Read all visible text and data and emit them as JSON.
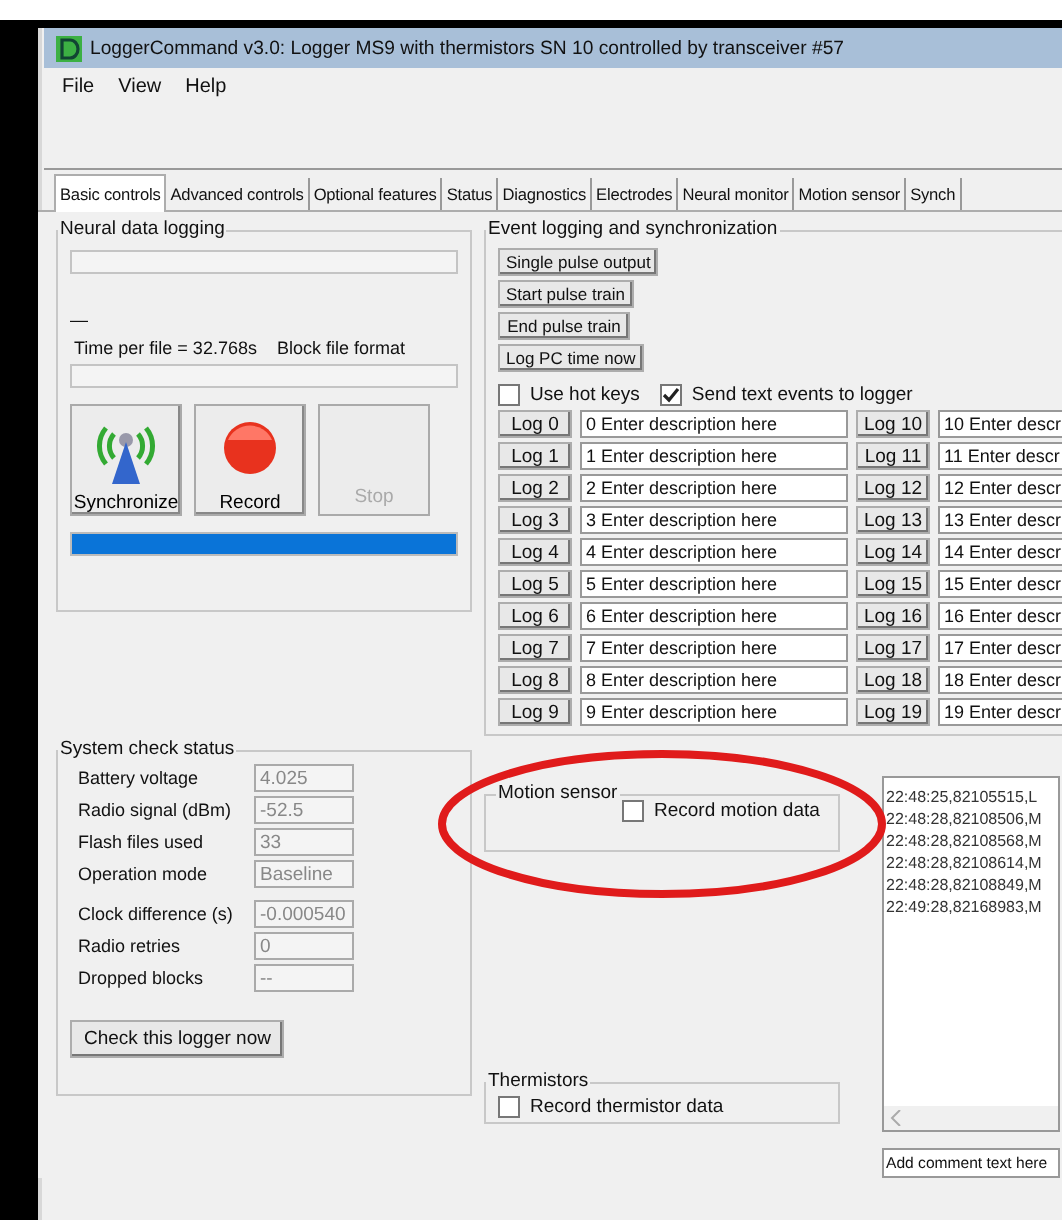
{
  "window": {
    "title": "LoggerCommand v3.0: Logger MS9 with thermistors SN 10 controlled by transceiver #57"
  },
  "menu": [
    "File",
    "View",
    "Help"
  ],
  "tabs": [
    {
      "label": "Basic controls",
      "selected": true
    },
    {
      "label": "Advanced controls",
      "selected": false
    },
    {
      "label": "Optional features",
      "selected": false
    },
    {
      "label": "Status",
      "selected": false
    },
    {
      "label": "Diagnostics",
      "selected": false
    },
    {
      "label": "Electrodes",
      "selected": false
    },
    {
      "label": "Neural monitor",
      "selected": false
    },
    {
      "label": "Motion sensor",
      "selected": false
    },
    {
      "label": "Synch",
      "selected": false
    }
  ],
  "neural_logging": {
    "title": "Neural data logging",
    "marker": "—",
    "time_per_file": "Time per file = 32.768s",
    "file_format": "Block file format",
    "buttons": [
      {
        "label": "Synchronize",
        "disabled": false
      },
      {
        "label": "Record",
        "disabled": false
      },
      {
        "label": "Stop",
        "disabled": true
      }
    ],
    "progress": {
      "level": 1
    }
  },
  "event_logging": {
    "title": "Event logging and synchronization",
    "buttons": [
      "Single pulse output",
      "Start pulse train",
      "End pulse train",
      "Log PC time now"
    ],
    "checkboxes": [
      {
        "label": "Use hot keys",
        "checked": false
      },
      {
        "label": "Send text events to logger",
        "checked": true
      }
    ],
    "log_rows": [
      {
        "button": "Log 0",
        "description": "0 Enter description here"
      },
      {
        "button": "Log 1",
        "description": "1 Enter description here"
      },
      {
        "button": "Log 2",
        "description": "2 Enter description here"
      },
      {
        "button": "Log 3",
        "description": "3 Enter description here"
      },
      {
        "button": "Log 4",
        "description": "4 Enter description here"
      },
      {
        "button": "Log 5",
        "description": "5 Enter description here"
      },
      {
        "button": "Log 6",
        "description": "6 Enter description here"
      },
      {
        "button": "Log 7",
        "description": "7 Enter description here"
      },
      {
        "button": "Log 8",
        "description": "8 Enter description here"
      },
      {
        "button": "Log 9",
        "description": "9 Enter description here"
      },
      {
        "button": "Log 10",
        "description": "10 Enter descr"
      },
      {
        "button": "Log 11",
        "description": "11 Enter descr"
      },
      {
        "button": "Log 12",
        "description": "12 Enter descr"
      },
      {
        "button": "Log 13",
        "description": "13 Enter descr"
      },
      {
        "button": "Log 14",
        "description": "14 Enter descr"
      },
      {
        "button": "Log 15",
        "description": "15 Enter descr"
      },
      {
        "button": "Log 16",
        "description": "16 Enter descr"
      },
      {
        "button": "Log 17",
        "description": "17 Enter descr"
      },
      {
        "button": "Log 18",
        "description": "18 Enter descr"
      },
      {
        "button": "Log 19",
        "description": "19 Enter descr"
      }
    ]
  },
  "system_check": {
    "title": "System check status",
    "field_groups": [
      [
        {
          "label": "Battery voltage",
          "value": "4.025"
        },
        {
          "label": "Radio signal (dBm)",
          "value": "-52.5"
        },
        {
          "label": "Flash files used",
          "value": "33"
        },
        {
          "label": "Operation mode",
          "value": "Baseline"
        }
      ],
      [
        {
          "label": "Clock difference (s)",
          "value": "-0.000540"
        },
        {
          "label": "Radio retries",
          "value": "0"
        },
        {
          "label": "Dropped blocks",
          "value": "--"
        }
      ]
    ],
    "button": "Check this logger now"
  },
  "motion_sensor": {
    "title": "Motion sensor",
    "checkbox": {
      "label": "Record motion data",
      "checked": false
    }
  },
  "thermistors": {
    "title": "Thermistors",
    "checkbox": {
      "label": "Record thermistor data",
      "checked": false
    }
  },
  "event_log": {
    "lines": [
      "22:48:25,82105515,L",
      "22:48:28,82108506,M",
      "22:48:28,82108568,M",
      "22:48:28,82108614,M",
      "22:48:28,82108849,M",
      "22:49:28,82168983,M"
    ],
    "comment_placeholder": "Add comment text here"
  },
  "annotation": {
    "kind": "ellipse"
  }
}
